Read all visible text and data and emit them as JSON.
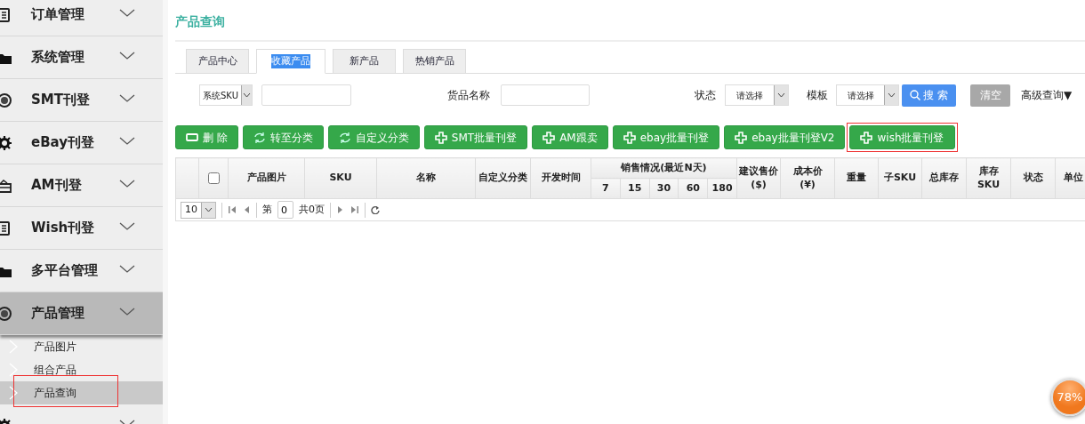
{
  "sidebar": {
    "items": [
      {
        "label": "订单管理",
        "expanded": false
      },
      {
        "label": "系统管理",
        "expanded": false
      },
      {
        "label": "SMT刊登",
        "expanded": false
      },
      {
        "label": "eBay刊登",
        "expanded": false
      },
      {
        "label": "AM刊登",
        "expanded": false
      },
      {
        "label": "Wish刊登",
        "expanded": false
      },
      {
        "label": "多平台管理",
        "expanded": false
      },
      {
        "label": "产品管理",
        "expanded": true,
        "children": [
          {
            "label": "产品图片",
            "selected": false,
            "highlighted": false
          },
          {
            "label": "组合产品",
            "selected": false,
            "highlighted": false
          },
          {
            "label": "产品查询",
            "selected": true,
            "highlighted": true
          }
        ]
      },
      {
        "expanded": false
      }
    ]
  },
  "page_title": "产品查询",
  "tabs": [
    {
      "label": "产品中心",
      "selected": false
    },
    {
      "label": "收藏产品",
      "selected": true
    },
    {
      "label": "新产品",
      "selected": false
    },
    {
      "label": "热销产品",
      "selected": false
    }
  ],
  "filters": {
    "sku_type": {
      "value": "系统SKU"
    },
    "goods_name": {
      "label": "货品名称"
    },
    "status": {
      "label": "状态",
      "value": "请选择"
    },
    "template": {
      "label": "模板",
      "value": "请选择"
    },
    "search_button": "搜 索",
    "clear_button": "清空",
    "advanced": "高级查询▼"
  },
  "actions": [
    {
      "label": "删 除",
      "kind": "minus",
      "highlighted": false
    },
    {
      "label": "转至分类",
      "kind": "refresh",
      "highlighted": false
    },
    {
      "label": "自定义分类",
      "kind": "refresh",
      "highlighted": false
    },
    {
      "label": "SMT批量刊登",
      "kind": "plus",
      "highlighted": false
    },
    {
      "label": "AM跟卖",
      "kind": "plus",
      "highlighted": false
    },
    {
      "label": "ebay批量刊登",
      "kind": "plus",
      "highlighted": false
    },
    {
      "label": "ebay批量刊登V2",
      "kind": "plus",
      "highlighted": false
    },
    {
      "label": "wish批量刊登",
      "kind": "plus",
      "highlighted": true
    }
  ],
  "table": {
    "columns": [
      {
        "kind": "blank"
      },
      {
        "kind": "checkbox",
        "checked": false
      },
      {
        "label": "产品图片"
      },
      {
        "label": "SKU"
      },
      {
        "label": "名称"
      },
      {
        "label": "自定义分类"
      },
      {
        "label": "开发时间"
      },
      {
        "label": "销售情况(最近N天)",
        "children": [
          {
            "label": "7"
          },
          {
            "label": "15"
          },
          {
            "label": "30"
          },
          {
            "label": "60"
          },
          {
            "label": "180"
          }
        ]
      },
      {
        "label": "建议售价\n($)"
      },
      {
        "label": "成本价\n(¥)"
      },
      {
        "label": "重量"
      },
      {
        "label": "子SKU"
      },
      {
        "label": "总库存"
      },
      {
        "label": "库存\nSKU"
      },
      {
        "label": "状态"
      },
      {
        "label": "单位"
      }
    ]
  },
  "pager": {
    "page_size": "10",
    "page_prefix": "第",
    "page": "0",
    "total": "共0页"
  },
  "speed_ball": {
    "reading": "78%"
  }
}
